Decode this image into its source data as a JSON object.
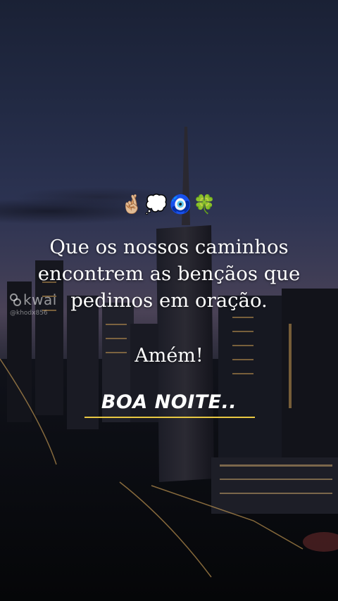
{
  "emoji": {
    "fingers": "🤞🏼",
    "thought": "💭",
    "nazar": "🧿",
    "clover": "🍀"
  },
  "message_lines": [
    "Que os nossos caminhos",
    "encontrem as bençãos que",
    "pedimos em oração."
  ],
  "amen": "Amém!",
  "greeting": "BOA NOITE..",
  "watermark": {
    "brand": "kwai",
    "handle": "@khodx856"
  },
  "colors": {
    "text": "#ffffff",
    "underline": "#e8c842",
    "sky_top": "#1a2135",
    "horizon": "#4a4256"
  }
}
